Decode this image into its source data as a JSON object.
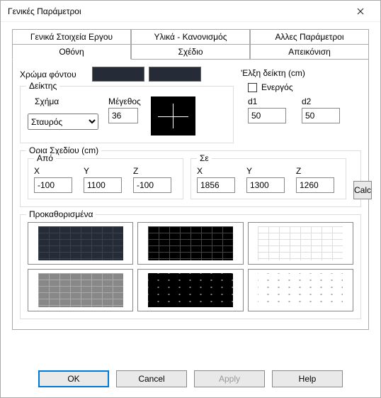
{
  "window": {
    "title": "Γενικές Παράμετροι"
  },
  "tabs": {
    "row1": [
      "Γενικά Στοιχεία Εργου",
      "Υλικά - Κανονισμός",
      "Αλλες Παράμετροι"
    ],
    "row2": [
      "Οθόνη",
      "Σχέδιο",
      "Απεικόνιση"
    ],
    "active": "Οθόνη"
  },
  "screen": {
    "bgcolor_label": "Χρώμα φόντου",
    "pointer": {
      "group_label": "Δείκτης",
      "shape_label": "Σχήμα",
      "size_label": "Μέγεθος",
      "shape_value": "Σταυρός",
      "shape_options": [
        "Σταυρός"
      ],
      "size_value": "36"
    },
    "snap": {
      "group_label": "'Ελξη δείκτη (cm)",
      "active_label": "Ενεργός",
      "active_checked": false,
      "d1_label": "d1",
      "d2_label": "d2",
      "d1_value": "50",
      "d2_value": "50"
    },
    "bounds": {
      "group_label": "Ορια Σχεδίου (cm)",
      "from_label": "Από",
      "to_label": "Σε",
      "x_label": "X",
      "y_label": "Y",
      "z_label": "Z",
      "from": {
        "x": "-100",
        "y": "1100",
        "z": "-100"
      },
      "to": {
        "x": "1856",
        "y": "1300",
        "z": "1260"
      },
      "calc_label": "Calc"
    },
    "presets": {
      "group_label": "Προκαθορισμένα"
    }
  },
  "buttons": {
    "ok": "OK",
    "cancel": "Cancel",
    "apply": "Apply",
    "help": "Help"
  }
}
